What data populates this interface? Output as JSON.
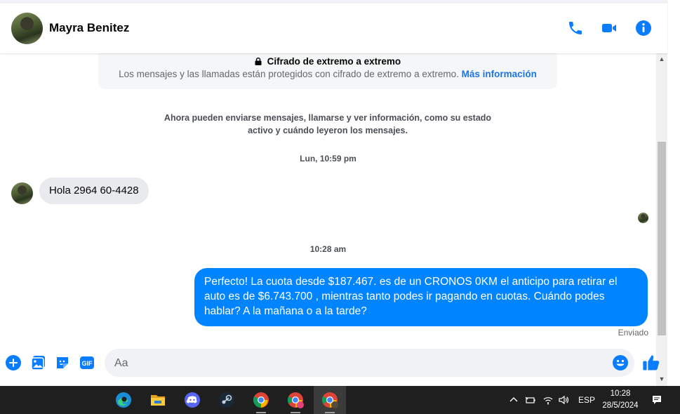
{
  "header": {
    "contact_name": "Mayra Benitez"
  },
  "encryption": {
    "title": "Cifrado de extremo a extremo",
    "description": "Los mensajes y las llamadas están protegidos con cifrado de extremo a extremo.",
    "link": "Más información"
  },
  "chat": {
    "info": "Ahora pueden enviarse mensajes, llamarse y ver información, como su estado activo y cuándo leyeron los mensajes.",
    "timestamp_1": "Lun, 10:59 pm",
    "incoming_message": "Hola 2964 60-4428",
    "timestamp_2": "10:28 am",
    "outgoing_message": "Perfecto! La cuota desde $187.467. es de un CRONOS 0KM el anticipo para retirar el auto es de $6.743.700 , mientras tanto podes ir pagando en cuotas. Cuándo podes hablar? A la mañana o a la tarde?",
    "sent_status": "Enviado"
  },
  "composer": {
    "placeholder": "Aa",
    "gif_label": "GIF"
  },
  "taskbar": {
    "language": "ESP",
    "time": "10:28",
    "date": "28/5/2024"
  },
  "colors": {
    "accent": "#0084ff",
    "link": "#1b74e4",
    "incoming_bubble": "#e9eaed",
    "taskbar": "#1f1f1f"
  }
}
